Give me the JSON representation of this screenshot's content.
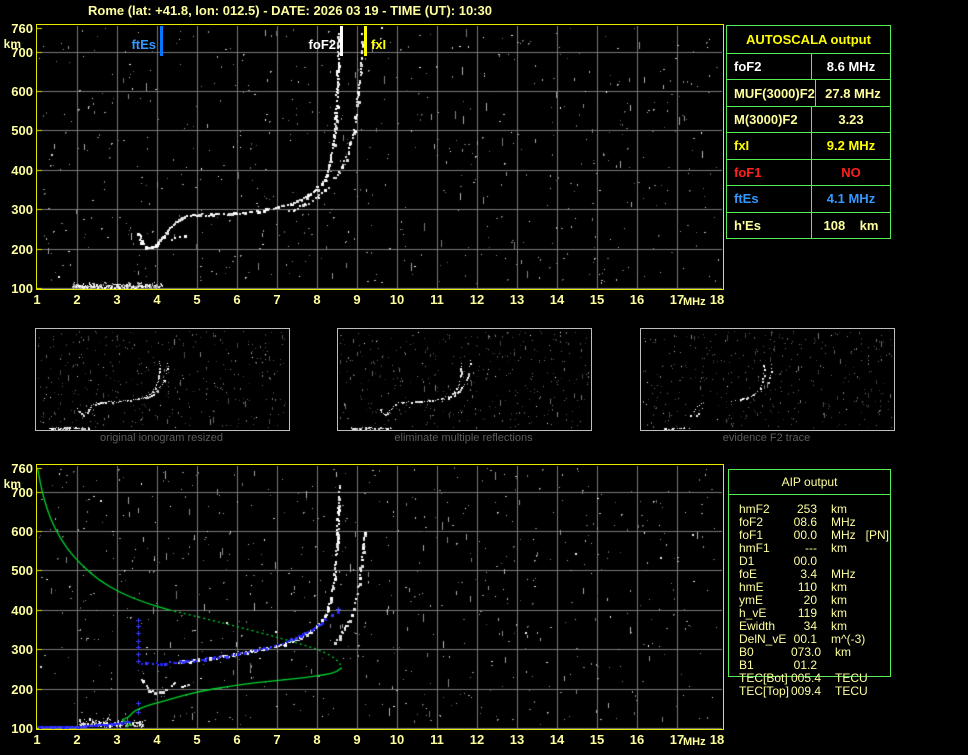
{
  "title": "Rome (lat: +41.8, lon: 012.5) - DATE: 2026 03 19 - TIME (UT): 10:30",
  "colors": {
    "background": "#000000",
    "axis_text": "#ffff9e",
    "plot_border": "#e8e800",
    "grid": "#787878",
    "trace_white": "#ffffff",
    "profile_green": "#00d42e",
    "trace_blue": "#2020ff",
    "table_border": "#55ee55",
    "caption_gray": "#5e5e5e"
  },
  "chart_data": [
    {
      "type": "scatter",
      "title": "recorded ionogram with autoscaled characteristic frequencies",
      "xlabel": "MHz",
      "ylabel": "km",
      "xlim": [
        1,
        18
      ],
      "ylim": [
        100,
        760
      ],
      "x_ticks": [
        1,
        2,
        3,
        4,
        5,
        6,
        7,
        8,
        9,
        10,
        11,
        12,
        13,
        14,
        15,
        16,
        17,
        18
      ],
      "y_ticks": [
        760,
        700,
        600,
        500,
        400,
        300,
        200,
        100
      ],
      "grid": true,
      "markers": [
        {
          "name": "ftEs",
          "freq_mhz": 4.1,
          "bar_color": "#0877ff",
          "text_color": "#3399ff",
          "label_side": "left"
        },
        {
          "name": "foF2",
          "freq_mhz": 8.6,
          "bar_color": "#ffffff",
          "text_color": "#ffffff",
          "label_side": "left"
        },
        {
          "name": "fxI",
          "freq_mhz": 9.2,
          "bar_color": "#ffff00",
          "text_color": "#ffff00",
          "label_side": "right"
        }
      ],
      "series": [
        {
          "name": "O-mode F trace",
          "points": [
            [
              3.52,
              242
            ],
            [
              3.6,
              220
            ],
            [
              3.72,
              205
            ],
            [
              3.84,
              203
            ],
            [
              3.97,
              213
            ],
            [
              4.12,
              230
            ],
            [
              4.28,
              252
            ],
            [
              4.45,
              270
            ],
            [
              4.65,
              281
            ],
            [
              4.9,
              286
            ],
            [
              5.4,
              289
            ],
            [
              6.0,
              292
            ],
            [
              6.5,
              297
            ],
            [
              7.0,
              306
            ],
            [
              7.35,
              316
            ],
            [
              7.7,
              331
            ],
            [
              8.0,
              353
            ],
            [
              8.2,
              382
            ],
            [
              8.33,
              422
            ],
            [
              8.42,
              485
            ],
            [
              8.47,
              565
            ],
            [
              8.5,
              655
            ],
            [
              8.52,
              750
            ]
          ]
        },
        {
          "name": "X-mode F trace",
          "points": [
            [
              7.3,
              296
            ],
            [
              7.7,
              315
            ],
            [
              8.0,
              333
            ],
            [
              8.3,
              361
            ],
            [
              8.55,
              396
            ],
            [
              8.75,
              442
            ],
            [
              8.9,
              502
            ],
            [
              9.0,
              572
            ],
            [
              9.08,
              652
            ],
            [
              9.13,
              748
            ]
          ]
        },
        {
          "name": "X-mode stub",
          "points": [
            [
              4.35,
              224
            ],
            [
              4.68,
              236
            ]
          ]
        },
        {
          "name": "Es layer echoes",
          "band_f": [
            1.88,
            4.15
          ],
          "band_h": [
            103,
            117
          ]
        }
      ]
    },
    {
      "type": "scatter",
      "title": "restored ionogram with autoscaled trace and electron density profile",
      "xlabel": "MHz",
      "ylabel": "km",
      "xlim": [
        1,
        18
      ],
      "ylim": [
        100,
        760
      ],
      "x_ticks": [
        1,
        2,
        3,
        4,
        5,
        6,
        7,
        8,
        9,
        10,
        11,
        12,
        13,
        14,
        15,
        16,
        17,
        18
      ],
      "y_ticks": [
        760,
        700,
        600,
        500,
        400,
        300,
        200,
        100
      ],
      "grid": true,
      "series": [
        {
          "name": "O-mode F trace",
          "points": [
            [
              4.5,
              268
            ],
            [
              4.9,
              274
            ],
            [
              5.4,
              280
            ],
            [
              5.9,
              288
            ],
            [
              6.4,
              297
            ],
            [
              6.9,
              308
            ],
            [
              7.3,
              320
            ],
            [
              7.7,
              338
            ],
            [
              8.0,
              360
            ],
            [
              8.2,
              388
            ],
            [
              8.33,
              425
            ],
            [
              8.43,
              490
            ],
            [
              8.48,
              570
            ],
            [
              8.52,
              660
            ],
            [
              8.54,
              720
            ]
          ]
        },
        {
          "name": "lower arc echo",
          "points": [
            [
              3.58,
              232
            ],
            [
              3.7,
              207
            ],
            [
              3.85,
              195
            ],
            [
              4.05,
              193
            ],
            [
              4.25,
              201
            ],
            [
              4.42,
              217
            ]
          ]
        },
        {
          "name": "short echo",
          "points": [
            [
              4.58,
              206
            ],
            [
              4.88,
              217
            ]
          ]
        },
        {
          "name": "X-mode F trace",
          "points": [
            [
              8.45,
              320
            ],
            [
              8.7,
              358
            ],
            [
              8.9,
              408
            ],
            [
              9.02,
              465
            ],
            [
              9.1,
              530
            ],
            [
              9.18,
              600
            ]
          ]
        },
        {
          "name": "Es layer echoes",
          "band_f": [
            2.05,
            3.7
          ],
          "band_h": [
            106,
            128
          ]
        },
        {
          "name": "autoscaled Es trace (blue)",
          "points": [
            [
              1.0,
              104
            ],
            [
              2.0,
              105
            ],
            [
              2.45,
              109
            ],
            [
              2.85,
              112
            ],
            [
              3.15,
              115
            ],
            [
              3.3,
              119
            ]
          ]
        },
        {
          "name": "autoscaled F trace (blue)",
          "points": [
            [
              3.62,
              267
            ],
            [
              3.9,
              265
            ],
            [
              4.3,
              267
            ],
            [
              4.7,
              271
            ],
            [
              5.1,
              276
            ],
            [
              5.5,
              282
            ],
            [
              6.0,
              290
            ],
            [
              6.5,
              300
            ],
            [
              7.0,
              312
            ],
            [
              7.4,
              328
            ],
            [
              7.7,
              344
            ],
            [
              8.0,
              362
            ],
            [
              8.2,
              378
            ],
            [
              8.35,
              390
            ],
            [
              8.5,
              398
            ]
          ]
        },
        {
          "name": "blue markers column",
          "freq_mhz": 3.52,
          "heights_km": [
            140,
            163,
            270,
            288,
            305,
            322,
            340,
            358,
            374
          ]
        },
        {
          "name": "blue end marker",
          "point": [
            8.52,
            402
          ]
        },
        {
          "name": "Ne profile upper (solid)",
          "points": [
            [
              1.02,
              757
            ],
            [
              1.1,
              710
            ],
            [
              1.25,
              655
            ],
            [
              1.45,
              605
            ],
            [
              1.75,
              555
            ],
            [
              2.1,
              515
            ],
            [
              2.55,
              475
            ],
            [
              3.1,
              442
            ],
            [
              3.7,
              418
            ],
            [
              4.3,
              400
            ]
          ]
        },
        {
          "name": "Ne profile upper (dotted)",
          "points": [
            [
              4.3,
              400
            ],
            [
              5.2,
              378
            ],
            [
              6.0,
              357
            ],
            [
              6.8,
              336
            ],
            [
              7.5,
              316
            ],
            [
              8.0,
              300
            ],
            [
              8.35,
              284
            ],
            [
              8.55,
              268
            ],
            [
              8.62,
              253
            ]
          ]
        },
        {
          "name": "Ne profile lower",
          "points": [
            [
              8.62,
              253
            ],
            [
              8.5,
              242
            ],
            [
              8.2,
              235
            ],
            [
              7.7,
              228
            ],
            [
              7.1,
              221
            ],
            [
              6.5,
              216
            ],
            [
              5.8,
              206
            ],
            [
              5.0,
              192
            ],
            [
              4.3,
              172
            ],
            [
              3.8,
              158
            ],
            [
              3.5,
              147
            ],
            [
              3.38,
              138
            ],
            [
              3.3,
              128
            ],
            [
              3.2,
              124
            ],
            [
              3.1,
              120
            ],
            [
              3.28,
              115
            ],
            [
              3.36,
              111
            ],
            [
              3.28,
              106
            ],
            [
              3.24,
              102
            ]
          ]
        }
      ]
    }
  ],
  "panels": [
    {
      "caption": "original ionogram resized",
      "style": "full"
    },
    {
      "caption": "eliminate multiple reflections",
      "style": "full"
    },
    {
      "caption": "evidence F2 trace",
      "style": "sparse"
    }
  ],
  "autoscala_table": {
    "title": "AUTOSCALA output",
    "rows": [
      {
        "label": "foF2",
        "value": "8.6 MHz",
        "color": "#ffffff"
      },
      {
        "label": "MUF(3000)F2",
        "value": "27.8 MHz",
        "color": "#ffff9e"
      },
      {
        "label": "M(3000)F2",
        "value": "3.23",
        "color": "#ffff9e"
      },
      {
        "label": "fxI",
        "value": "9.2 MHz",
        "color": "#ffff00"
      },
      {
        "label": "foF1",
        "value": "NO",
        "color": "#ff2020"
      },
      {
        "label": "ftEs",
        "value": "4.1 MHz",
        "color": "#3399ff"
      },
      {
        "label": "h'Es",
        "value": "108    km",
        "color": "#ffff9e"
      }
    ]
  },
  "aip_table": {
    "title": "AIP output",
    "rows": [
      {
        "label": "hmF2",
        "value": "253",
        "unit": "km",
        "extra": ""
      },
      {
        "label": "foF2",
        "value": "08.6",
        "unit": "MHz",
        "extra": ""
      },
      {
        "label": "foF1",
        "value": "00.0",
        "unit": "MHz",
        "extra": "[PN]"
      },
      {
        "label": "hmF1",
        "value": "---",
        "unit": "km",
        "extra": ""
      },
      {
        "label": "D1",
        "value": "00.0",
        "unit": "",
        "extra": ""
      },
      {
        "label": "foE",
        "value": "3.4",
        "unit": "MHz",
        "extra": ""
      },
      {
        "label": "hmE",
        "value": "110",
        "unit": "km",
        "extra": ""
      },
      {
        "label": "ymE",
        "value": "20",
        "unit": "km",
        "extra": ""
      },
      {
        "label": "h_vE",
        "value": "119",
        "unit": "km",
        "extra": ""
      },
      {
        "label": "Ewidth",
        "value": "34",
        "unit": "km",
        "extra": ""
      },
      {
        "label": "DelN_vE",
        "value": "00.1",
        "unit": "m^(-3)",
        "extra": ""
      },
      {
        "label": "B0",
        "value": "073.0",
        "unit": "km",
        "extra": ""
      },
      {
        "label": "B1",
        "value": "01.2",
        "unit": "",
        "extra": ""
      },
      {
        "label": "TEC[Bot]",
        "value": "005.4",
        "unit": "TECU",
        "extra": ""
      },
      {
        "label": "TEC[Top]",
        "value": "009.4",
        "unit": "TECU",
        "extra": ""
      }
    ]
  }
}
